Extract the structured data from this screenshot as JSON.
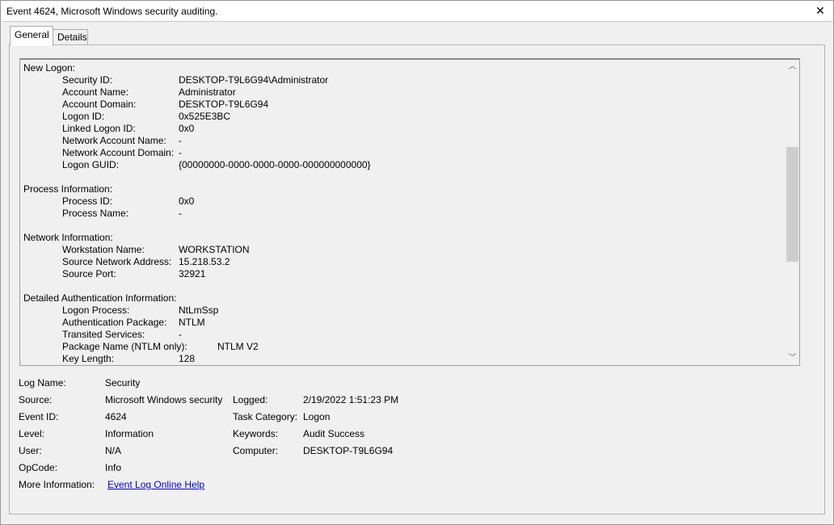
{
  "window": {
    "title": "Event 4624, Microsoft Windows security auditing."
  },
  "tabs": [
    {
      "label": "General"
    },
    {
      "label": "Details"
    }
  ],
  "description": {
    "new_logon": {
      "title": "New Logon:",
      "fields": [
        {
          "label": "Security ID:",
          "value": "DESKTOP-T9L6G94\\Administrator"
        },
        {
          "label": "Account Name:",
          "value": "Administrator"
        },
        {
          "label": "Account Domain:",
          "value": "DESKTOP-T9L6G94"
        },
        {
          "label": "Logon ID:",
          "value": "0x525E3BC"
        },
        {
          "label": "Linked Logon ID:",
          "value": "0x0"
        },
        {
          "label": "Network Account Name:",
          "value": "-"
        },
        {
          "label": "Network Account Domain:",
          "value": "-"
        },
        {
          "label": "Logon GUID:",
          "value": "{00000000-0000-0000-0000-000000000000}"
        }
      ]
    },
    "process": {
      "title": "Process Information:",
      "fields": [
        {
          "label": "Process ID:",
          "value": "0x0"
        },
        {
          "label": "Process Name:",
          "value": "-"
        }
      ]
    },
    "network": {
      "title": "Network Information:",
      "fields": [
        {
          "label": "Workstation Name:",
          "value": "WORKSTATION"
        },
        {
          "label": "Source Network Address:",
          "value": "15.218.53.2"
        },
        {
          "label": "Source Port:",
          "value": "32921"
        }
      ]
    },
    "auth": {
      "title": "Detailed Authentication Information:",
      "fields": [
        {
          "label": "Logon Process:",
          "value": "NtLmSsp"
        },
        {
          "label": "Authentication Package:",
          "value": "NTLM"
        },
        {
          "label": "Transited Services:",
          "value": "-"
        },
        {
          "label": "Package Name (NTLM only):",
          "value": "NTLM V2"
        },
        {
          "label": "Key Length:",
          "value": "128"
        }
      ]
    }
  },
  "properties": {
    "log_name": {
      "label": "Log Name:",
      "value": "Security"
    },
    "source": {
      "label": "Source:",
      "value": "Microsoft Windows security"
    },
    "logged": {
      "label": "Logged:",
      "value": "2/19/2022 1:51:23 PM"
    },
    "event_id": {
      "label": "Event ID:",
      "value": "4624"
    },
    "task_category": {
      "label": "Task Category:",
      "value": "Logon"
    },
    "level": {
      "label": "Level:",
      "value": "Information"
    },
    "keywords": {
      "label": "Keywords:",
      "value": "Audit Success"
    },
    "user": {
      "label": "User:",
      "value": "N/A"
    },
    "computer": {
      "label": "Computer:",
      "value": "DESKTOP-T9L6G94"
    },
    "opcode": {
      "label": "OpCode:",
      "value": "Info"
    },
    "more_info": {
      "label": "More Information:",
      "link": "Event Log Online Help"
    }
  }
}
